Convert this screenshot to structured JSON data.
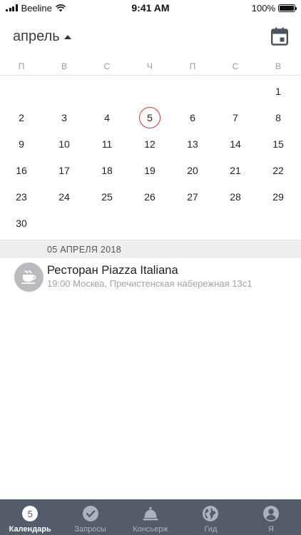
{
  "status_bar": {
    "carrier": "Beeline",
    "time": "9:41 AM",
    "battery": "100%",
    "battery_level": 1.0
  },
  "header": {
    "month": "апрель",
    "calendar_icon": "calendar-icon"
  },
  "weekdays": [
    "П",
    "В",
    "С",
    "Ч",
    "П",
    "С",
    "В"
  ],
  "days": [
    "1",
    "2",
    "3",
    "4",
    "5",
    "6",
    "7",
    "8",
    "9",
    "10",
    "11",
    "12",
    "13",
    "14",
    "15",
    "16",
    "17",
    "18",
    "19",
    "20",
    "21",
    "22",
    "23",
    "24",
    "25",
    "26",
    "27",
    "28",
    "29",
    "30"
  ],
  "today": "5",
  "colors": {
    "today_ring": "#d32f2f",
    "tabbar_bg": "#525c6b",
    "date_band_bg": "#efeff1"
  },
  "events_section": {
    "date": "05 АПРЕЛЯ 2018",
    "events": [
      {
        "title": "Ресторан Piazza Italiana",
        "subtitle": "19:00 Москва, Пречистенская набережная 13с1",
        "icon": "coffee-cup-icon"
      }
    ]
  },
  "tabbar": {
    "tabs": [
      {
        "label": "Календарь",
        "icon": "calendar-badge-icon",
        "badge": "5",
        "active": true
      },
      {
        "label": "Запросы",
        "icon": "check-circle-icon",
        "active": false
      },
      {
        "label": "Консьерж",
        "icon": "service-bell-icon",
        "active": false
      },
      {
        "label": "Гид",
        "icon": "globe-icon",
        "active": false
      },
      {
        "label": "Я",
        "icon": "profile-icon",
        "active": false
      }
    ]
  }
}
